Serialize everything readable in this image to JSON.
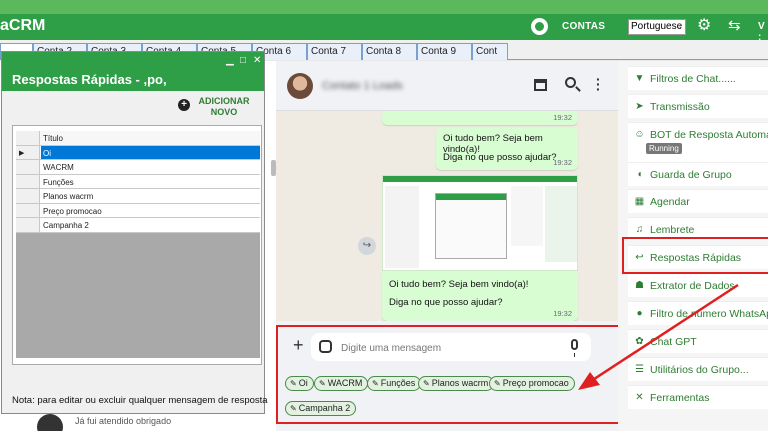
{
  "app": {
    "title": "aCRM",
    "contas_label": "CONTAS",
    "language": "Portuguese",
    "version": "V :"
  },
  "account_tabs": [
    "",
    "Conta 2",
    "Conta 3",
    "Conta 4",
    "Conta 5",
    "Conta 6",
    "Conta 7",
    "Conta 8",
    "Conta 9",
    "Cont"
  ],
  "chat": {
    "contact_name": "Contato 1 Loads",
    "messages": [
      {
        "time": "19:32"
      },
      {
        "lines": [
          "Oi tudo bem? Seja bem vindo(a)!",
          "Diga no que posso ajudar?"
        ],
        "time": "19:32"
      },
      {
        "lines": [
          "Oi tudo bem? Seja bem vindo(a)!",
          "Diga no que posso ajudar?"
        ],
        "time": "19:32"
      }
    ],
    "input_placeholder": "Digite uma mensagem",
    "quick_chips": [
      "Oi",
      "WACRM",
      "Funções",
      "Planos wacrm",
      "Preço promocao",
      "Campanha 2"
    ]
  },
  "sidebar": {
    "items": [
      {
        "icon": "filter-icon",
        "label": "Filtros de Chat......"
      },
      {
        "icon": "send-icon",
        "label": "Transmissão"
      },
      {
        "icon": "robot-icon",
        "label": "BOT de Resposta Automática",
        "badge": "Running"
      },
      {
        "icon": "shield-icon",
        "label": "Guarda de Grupo"
      },
      {
        "icon": "calendar-icon",
        "label": "Agendar"
      },
      {
        "icon": "bell-icon",
        "label": "Lembrete"
      },
      {
        "icon": "reply-icon",
        "label": "Respostas Rápidas"
      },
      {
        "icon": "users-icon",
        "label": "Extrator de Dados"
      },
      {
        "icon": "whatsapp-filter-icon",
        "label": "Filtro de número WhatsApp"
      },
      {
        "icon": "chatgpt-icon",
        "label": "Chat GPT"
      },
      {
        "icon": "list-icon",
        "label": "Utilitários do Grupo..."
      },
      {
        "icon": "tools-icon",
        "label": "Ferramentas"
      }
    ]
  },
  "quick_replies_window": {
    "title": "Respostas Rápidas - ,po,",
    "add_button": "ADICIONAR NOVO",
    "column_header": "Título",
    "rows": [
      "Oi",
      "WACRM",
      "Funções",
      "Planos wacrm",
      "Preço promocao",
      "Campanha 2"
    ],
    "selected_row": "Oi",
    "note": "Nota: para editar ou excluir qualquer mensagem de resposta"
  },
  "behind_preview": {
    "text": "Já fui atendido obrigado"
  },
  "colors": {
    "brand_green": "#2e9e47",
    "highlight_red": "#e02020",
    "selection_blue": "#0078d7"
  }
}
